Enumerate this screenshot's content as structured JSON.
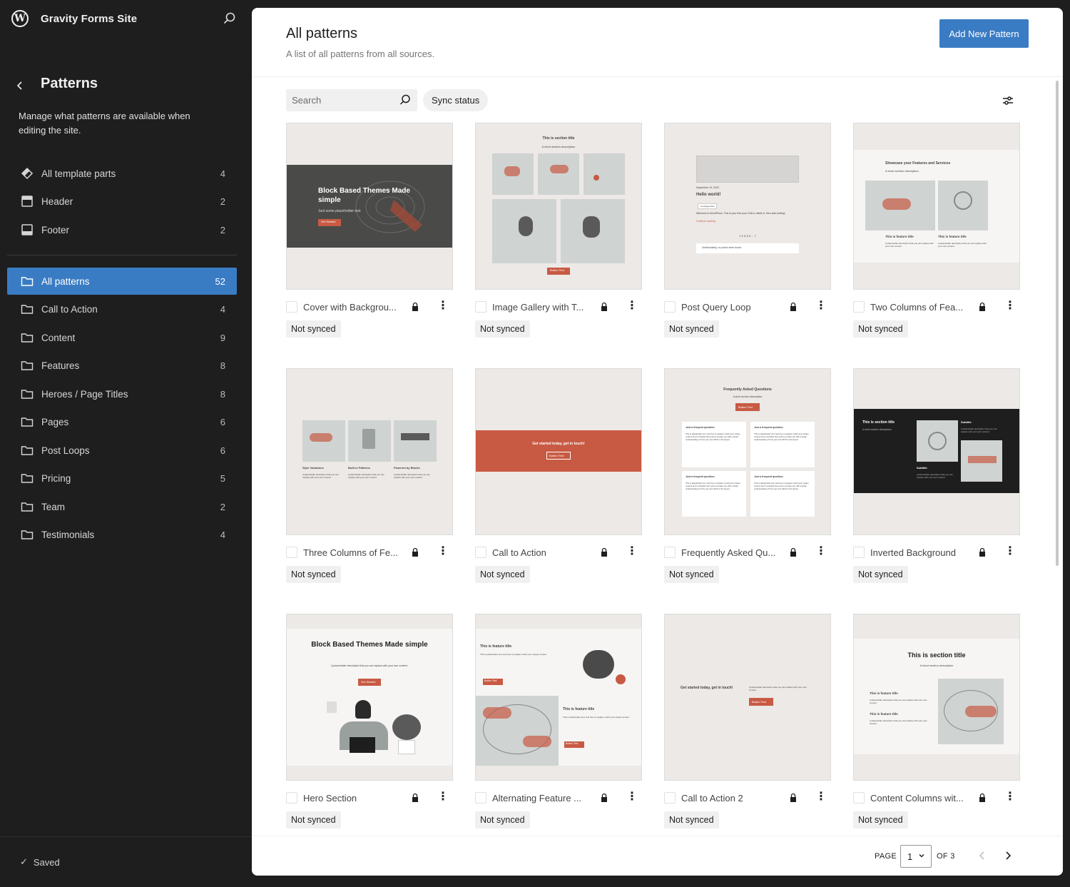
{
  "site": {
    "name": "Gravity Forms Site",
    "logo_letter": "W"
  },
  "sidebar": {
    "title": "Patterns",
    "description": "Manage what patterns are available when editing the site.",
    "template_parts": [
      {
        "label": "All template parts",
        "count": "4",
        "icon": "template-parts-icon"
      },
      {
        "label": "Header",
        "count": "2",
        "icon": "header-icon"
      },
      {
        "label": "Footer",
        "count": "2",
        "icon": "footer-icon"
      }
    ],
    "categories": [
      {
        "label": "All patterns",
        "count": "52",
        "active": true
      },
      {
        "label": "Call to Action",
        "count": "4"
      },
      {
        "label": "Content",
        "count": "9"
      },
      {
        "label": "Features",
        "count": "8"
      },
      {
        "label": "Heroes / Page Titles",
        "count": "8"
      },
      {
        "label": "Pages",
        "count": "6"
      },
      {
        "label": "Post Loops",
        "count": "6"
      },
      {
        "label": "Pricing",
        "count": "5"
      },
      {
        "label": "Team",
        "count": "2"
      },
      {
        "label": "Testimonials",
        "count": "4"
      }
    ],
    "saved_label": "Saved"
  },
  "main": {
    "title": "All patterns",
    "subtitle": "A list of all patterns from all sources.",
    "add_button": "Add New Pattern",
    "search_placeholder": "Search",
    "sync_filter": "Sync status"
  },
  "patterns": [
    {
      "title": "Cover with Backgrou...",
      "status": "Not synced",
      "thumb": {
        "heading": "Block Based Themes Made simple",
        "text": "Just some placeholder text",
        "button": "Get Started"
      }
    },
    {
      "title": "Image Gallery with T...",
      "status": "Not synced",
      "thumb": {
        "heading": "This is section title",
        "text": "A short section description",
        "button": "Button Text"
      }
    },
    {
      "title": "Post Query Loop",
      "status": "Not synced",
      "thumb": {
        "heading": "Hello world!",
        "date": "September 19, 2023",
        "chip": "Uncategorized",
        "text": "Welcome to WordPress. This is your first post. Edit or delete it, then start writing!",
        "link": "Continue reading",
        "pager": "1 2 3 4 5 ... 7",
        "notice": "Unfortunately, no post's were found."
      }
    },
    {
      "title": "Two Columns of Fea...",
      "status": "Not synced",
      "thumb": {
        "heading": "Showcase your Features and Services",
        "text": "A short section description",
        "feature_title": "This is feature title",
        "feature_text": "A placeholder description that you can replace with your own content."
      }
    },
    {
      "title": "Three Columns of Fe...",
      "status": "Not synced",
      "thumb": {
        "col1": "Style Variations",
        "col2": "Built-in Patterns",
        "col3": "Powered by Blocks",
        "text": "A placeholder description that you can replace with your own content."
      }
    },
    {
      "title": "Call to Action",
      "status": "Not synced",
      "thumb": {
        "heading": "Get started today, get in touch!",
        "button": "Button Text"
      }
    },
    {
      "title": "Frequently Asked Qu...",
      "status": "Not synced",
      "thumb": {
        "heading": "Frequently Asked Questions",
        "text": "A short section description",
        "button": "Button Text",
        "question": "Just a frequent question",
        "answer": "This is placeholder text, feel free to replace it with your unique content as it's included here just to provide you with a better understanding of how your text will fit in the layout."
      }
    },
    {
      "title": "Inverted Background",
      "status": "Not synced",
      "thumb": {
        "heading": "This is section title",
        "text": "A short section description",
        "subtitle": "Subtitle",
        "sub_text": "A placeholder description that you can replace with your own content."
      }
    },
    {
      "title": "Hero Section",
      "status": "Not synced",
      "thumb": {
        "heading": "Block Based Themes Made simple",
        "text": "A placeholder description that you can replace with your own content.",
        "button": "Get Started"
      }
    },
    {
      "title": "Alternating Feature ...",
      "status": "Not synced",
      "thumb": {
        "heading": "This is feature title",
        "text": "This is placeholder text, feel free to replace it with your unique content.",
        "button": "Button Text"
      }
    },
    {
      "title": "Call to Action 2",
      "status": "Not synced",
      "thumb": {
        "heading": "Get started today, get in touch!",
        "text": "A placeholder description that you can replace with your own content.",
        "button": "Button Text"
      }
    },
    {
      "title": "Content Columns wit...",
      "status": "Not synced",
      "thumb": {
        "heading": "This is section title",
        "text": "A short section description",
        "feature_title": "This is feature title",
        "feature_text": "A placeholder description that you can replace with your own content."
      }
    }
  ],
  "pagination": {
    "page_label": "PAGE",
    "current": "1",
    "of_label": "OF 3"
  },
  "colors": {
    "accent": "#3a7cc4",
    "sidebar_bg": "#1e1e1e",
    "thumb_bg": "#ece9e6",
    "pattern_red": "#c85a43"
  }
}
